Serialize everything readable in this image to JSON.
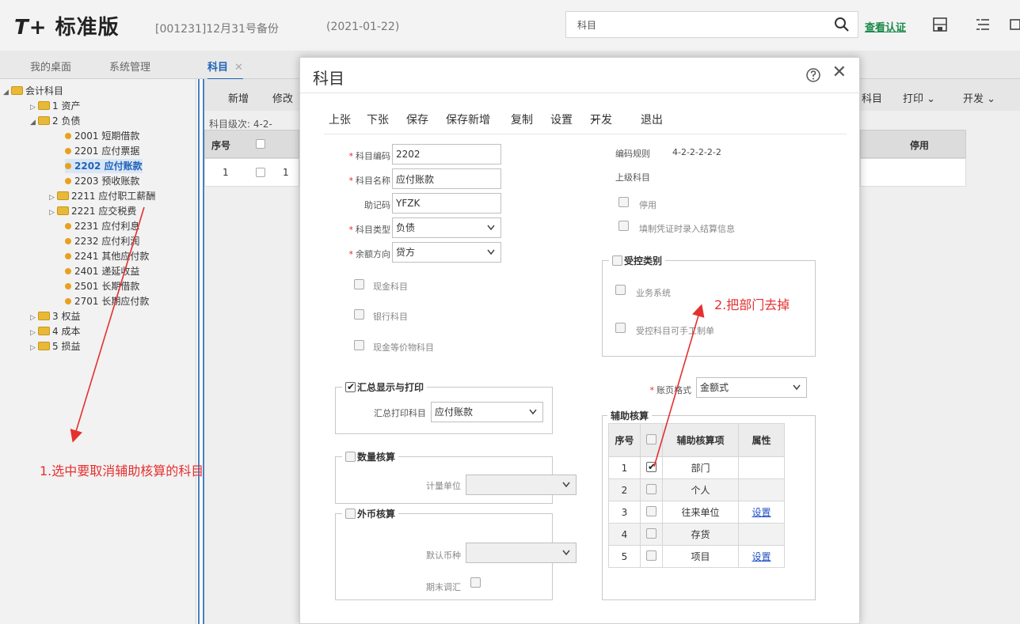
{
  "app": {
    "logo_prefix": "T+",
    "logo_text": "标准版",
    "account": "[001231]12月31号备份",
    "date": "(2021-01-22)",
    "search_value": "科目",
    "cert_link": "查看认证"
  },
  "tabs": {
    "desktop": "我的桌面",
    "sysmgmt": "系统管理",
    "subjects": "科目"
  },
  "tree": {
    "root": "会计科目",
    "assets": "1 资产",
    "liabilities": "2 负债",
    "items": [
      "2001 短期借款",
      "2201 应付票据",
      "2202 应付账款",
      "2203 预收账款",
      "2211 应付职工薪酬",
      "2221 应交税费",
      "2231 应付利息",
      "2232 应付利润",
      "2241 其他应付款",
      "2401 递延收益",
      "2501 长期借款",
      "2701 长期应付款"
    ],
    "equity": "3 权益",
    "cost": "4 成本",
    "pnl": "5 损益"
  },
  "list": {
    "btn_new": "新增",
    "btn_edit": "修改",
    "btn_subject_partial": "科目",
    "btn_print": "打印",
    "btn_dev": "开发",
    "level_label": "科目级次:",
    "level_value": "4-2-",
    "col_seq": "序号",
    "col_disabled": "停用",
    "row_seq": "1",
    "row_partial": "1"
  },
  "dialog": {
    "title": "科目",
    "toolbar": {
      "prev": "上张",
      "next": "下张",
      "save": "保存",
      "save_new": "保存新增",
      "copy": "复制",
      "settings": "设置",
      "dev": "开发",
      "exit": "退出"
    },
    "code_label": "科目编码",
    "code_value": "2202",
    "name_label": "科目名称",
    "name_value": "应付账款",
    "mnemonic_label": "助记码",
    "mnemonic_value": "YFZK",
    "type_label": "科目类型",
    "type_value": "负债",
    "balance_label": "余额方向",
    "balance_value": "贷方",
    "cash_subject": "现金科目",
    "bank_subject": "银行科目",
    "cash_equiv": "现金等价物科目",
    "code_rule_label": "编码规则",
    "code_rule_value": "4-2-2-2-2-2",
    "parent_label": "上级科目",
    "disabled": "停用",
    "settle_info": "填制凭证时录入结算信息",
    "controlled_group": "受控类别",
    "biz_system": "业务系统",
    "controlled_manual": "受控科目可手工制单",
    "summary_group": "汇总显示与打印",
    "summary_print_label": "汇总打印科目",
    "summary_print_value": "应付账款",
    "qty_group": "数量核算",
    "unit_label": "计量单位",
    "fx_group": "外币核算",
    "default_currency": "默认币种",
    "period_end_fx": "期末调汇",
    "ledger_format_label": "账页格式",
    "ledger_format_value": "金额式",
    "aux_group": "辅助核算",
    "aux_headers": {
      "seq": "序号",
      "item": "辅助核算项",
      "attr": "属性"
    },
    "aux_rows": [
      {
        "seq": "1",
        "item": "部门",
        "attr": ""
      },
      {
        "seq": "2",
        "item": "个人",
        "attr": ""
      },
      {
        "seq": "3",
        "item": "往来单位",
        "attr": "设置"
      },
      {
        "seq": "4",
        "item": "存货",
        "attr": ""
      },
      {
        "seq": "5",
        "item": "项目",
        "attr": "设置"
      }
    ]
  },
  "annotations": {
    "step1": "1.选中要取消辅助核算的科目",
    "step2": "2.把部门去掉"
  },
  "colors": {
    "accent_blue": "#1f63b6",
    "annotation_red": "#e53030",
    "link_green": "#1a8a4a"
  }
}
